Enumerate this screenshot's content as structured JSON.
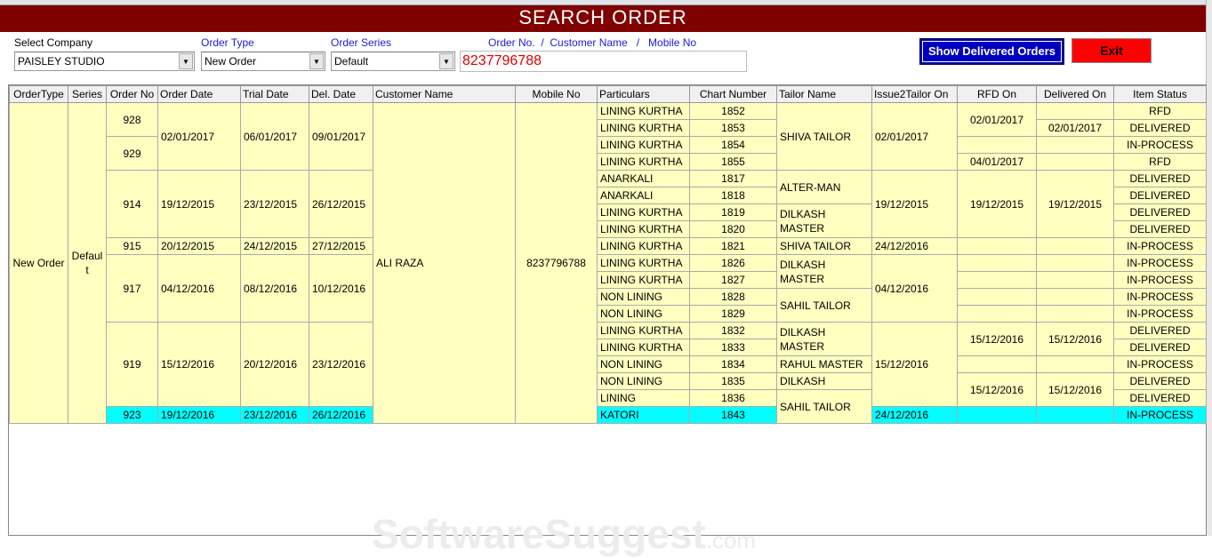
{
  "window": {
    "title": "SEARCH ORDER"
  },
  "filters": {
    "company_label": "Select Company",
    "company_value": "PAISLEY STUDIO",
    "order_type_label": "Order Type",
    "order_type_value": "New Order",
    "order_series_label": "Order Series",
    "order_series_value": "Default",
    "search_label": "Order No.  /  Customer Name   /   Mobile No",
    "search_value": "8237796788"
  },
  "buttons": {
    "show_delivered": "Show Delivered Orders",
    "exit": "Exit"
  },
  "colors": {
    "title_bg": "#800000",
    "cell_bg": "#ffffc0",
    "highlight": "#00ffff",
    "show_btn": "#0000c0",
    "exit_btn": "#ff0000"
  },
  "watermark": {
    "main": "SoftwareSuggest",
    "suffix": ".com"
  },
  "table": {
    "row_count": 19,
    "highlighted_row": 18,
    "columns": [
      {
        "key": "order_type",
        "label": "OrderType",
        "w": 66,
        "align": "c",
        "cells": [
          [
            "New Order",
            19
          ]
        ]
      },
      {
        "key": "series",
        "label": "Series",
        "w": 43,
        "align": "c",
        "cells": [
          [
            "Default",
            19
          ]
        ]
      },
      {
        "key": "order_no",
        "label": "Order No",
        "w": 58,
        "align": "c",
        "cells": [
          [
            "928",
            2
          ],
          [
            "929",
            2
          ],
          [
            "914",
            4
          ],
          [
            "915",
            1
          ],
          [
            "917",
            4
          ],
          [
            "919",
            5
          ],
          [
            "923",
            1
          ]
        ]
      },
      {
        "key": "order_date",
        "label": "Order Date",
        "w": 93,
        "cells": [
          [
            "02/01/2017",
            4
          ],
          [
            "19/12/2015",
            4
          ],
          [
            "20/12/2015",
            1
          ],
          [
            "04/12/2016",
            4
          ],
          [
            "15/12/2016",
            5
          ],
          [
            "19/12/2016",
            1
          ]
        ]
      },
      {
        "key": "trial_date",
        "label": "Trial Date",
        "w": 77,
        "cells": [
          [
            "06/01/2017",
            4
          ],
          [
            "23/12/2015",
            4
          ],
          [
            "24/12/2015",
            1
          ],
          [
            "08/12/2016",
            4
          ],
          [
            "20/12/2016",
            5
          ],
          [
            "23/12/2016",
            1
          ]
        ]
      },
      {
        "key": "del_date",
        "label": "Del. Date",
        "w": 72,
        "cells": [
          [
            "09/01/2017",
            4
          ],
          [
            "26/12/2015",
            4
          ],
          [
            "27/12/2015",
            1
          ],
          [
            "10/12/2016",
            4
          ],
          [
            "23/12/2016",
            5
          ],
          [
            "26/12/2016",
            1
          ]
        ]
      },
      {
        "key": "customer",
        "label": "Customer Name",
        "w": 160,
        "cells": [
          [
            "ALI RAZA",
            19
          ]
        ]
      },
      {
        "key": "mobile",
        "label": "Mobile No",
        "w": 92,
        "align": "c",
        "cells": [
          [
            "8237796788",
            19
          ]
        ]
      },
      {
        "key": "particulars",
        "label": "Particulars",
        "w": 104,
        "cells": [
          [
            "LINING KURTHA",
            1
          ],
          [
            "LINING KURTHA",
            1
          ],
          [
            "LINING KURTHA",
            1
          ],
          [
            "LINING KURTHA",
            1
          ],
          [
            "ANARKALI",
            1
          ],
          [
            "ANARKALI",
            1
          ],
          [
            "LINING KURTHA",
            1
          ],
          [
            "LINING KURTHA",
            1
          ],
          [
            "LINING KURTHA",
            1
          ],
          [
            "LINING KURTHA",
            1
          ],
          [
            "LINING KURTHA",
            1
          ],
          [
            "NON LINING",
            1
          ],
          [
            "NON LINING",
            1
          ],
          [
            "LINING KURTHA",
            1
          ],
          [
            "LINING KURTHA",
            1
          ],
          [
            "NON LINING",
            1
          ],
          [
            "NON LINING",
            1
          ],
          [
            "LINING",
            1
          ],
          [
            "KATORI",
            1
          ]
        ]
      },
      {
        "key": "chart",
        "label": "Chart Number",
        "w": 98,
        "align": "c",
        "cells": [
          [
            "1852",
            1
          ],
          [
            "1853",
            1
          ],
          [
            "1854",
            1
          ],
          [
            "1855",
            1
          ],
          [
            "1817",
            1
          ],
          [
            "1818",
            1
          ],
          [
            "1819",
            1
          ],
          [
            "1820",
            1
          ],
          [
            "1821",
            1
          ],
          [
            "1826",
            1
          ],
          [
            "1827",
            1
          ],
          [
            "1828",
            1
          ],
          [
            "1829",
            1
          ],
          [
            "1832",
            1
          ],
          [
            "1833",
            1
          ],
          [
            "1834",
            1
          ],
          [
            "1835",
            1
          ],
          [
            "1836",
            1
          ],
          [
            "1843",
            1
          ]
        ]
      },
      {
        "key": "tailor",
        "label": "Tailor Name",
        "w": 107,
        "cells": [
          [
            "SHIVA TAILOR",
            4
          ],
          [
            "ALTER-MAN",
            2
          ],
          [
            "DILKASH MASTER",
            2
          ],
          [
            "SHIVA TAILOR",
            1
          ],
          [
            "DILKASH MASTER",
            2
          ],
          [
            "SAHIL TAILOR",
            2
          ],
          [
            "DILKASH MASTER",
            2
          ],
          [
            "RAHUL MASTER",
            1
          ],
          [
            "DILKASH",
            1
          ],
          [
            "SAHIL TAILOR",
            2
          ]
        ]
      },
      {
        "key": "issue",
        "label": "Issue2Tailor On",
        "w": 96,
        "cells": [
          [
            "02/01/2017",
            4
          ],
          [
            "19/12/2015",
            4
          ],
          [
            "24/12/2016",
            1
          ],
          [
            "04/12/2016",
            4
          ],
          [
            "15/12/2016",
            5
          ],
          [
            "24/12/2016",
            1
          ]
        ]
      },
      {
        "key": "rfd",
        "label": "RFD On",
        "w": 89,
        "align": "c",
        "cells": [
          [
            "02/01/2017",
            2
          ],
          [
            "",
            1
          ],
          [
            "04/01/2017",
            1
          ],
          [
            "19/12/2015",
            4
          ],
          [
            "",
            1
          ],
          [
            "",
            1
          ],
          [
            "",
            1
          ],
          [
            "",
            1
          ],
          [
            "",
            1
          ],
          [
            "15/12/2016",
            2
          ],
          [
            "",
            1
          ],
          [
            "15/12/2016",
            2
          ],
          [
            "",
            1
          ]
        ]
      },
      {
        "key": "delivered",
        "label": "Delivered On",
        "w": 87,
        "align": "c",
        "cells": [
          [
            "",
            1
          ],
          [
            "02/01/2017",
            1
          ],
          [
            "",
            1
          ],
          [
            "",
            1
          ],
          [
            "19/12/2015",
            4
          ],
          [
            "",
            1
          ],
          [
            "",
            1
          ],
          [
            "",
            1
          ],
          [
            "",
            1
          ],
          [
            "",
            1
          ],
          [
            "15/12/2016",
            2
          ],
          [
            "",
            1
          ],
          [
            "15/12/2016",
            2
          ],
          [
            "",
            1
          ]
        ]
      },
      {
        "key": "status",
        "label": "Item Status",
        "w": 104,
        "align": "c",
        "cells": [
          [
            "RFD",
            1
          ],
          [
            "DELIVERED",
            1
          ],
          [
            "IN-PROCESS",
            1
          ],
          [
            "RFD",
            1
          ],
          [
            "DELIVERED",
            1
          ],
          [
            "DELIVERED",
            1
          ],
          [
            "DELIVERED",
            1
          ],
          [
            "DELIVERED",
            1
          ],
          [
            "IN-PROCESS",
            1
          ],
          [
            "IN-PROCESS",
            1
          ],
          [
            "IN-PROCESS",
            1
          ],
          [
            "IN-PROCESS",
            1
          ],
          [
            "IN-PROCESS",
            1
          ],
          [
            "DELIVERED",
            1
          ],
          [
            "DELIVERED",
            1
          ],
          [
            "IN-PROCESS",
            1
          ],
          [
            "DELIVERED",
            1
          ],
          [
            "DELIVERED",
            1
          ],
          [
            "IN-PROCESS",
            1
          ]
        ]
      }
    ]
  }
}
